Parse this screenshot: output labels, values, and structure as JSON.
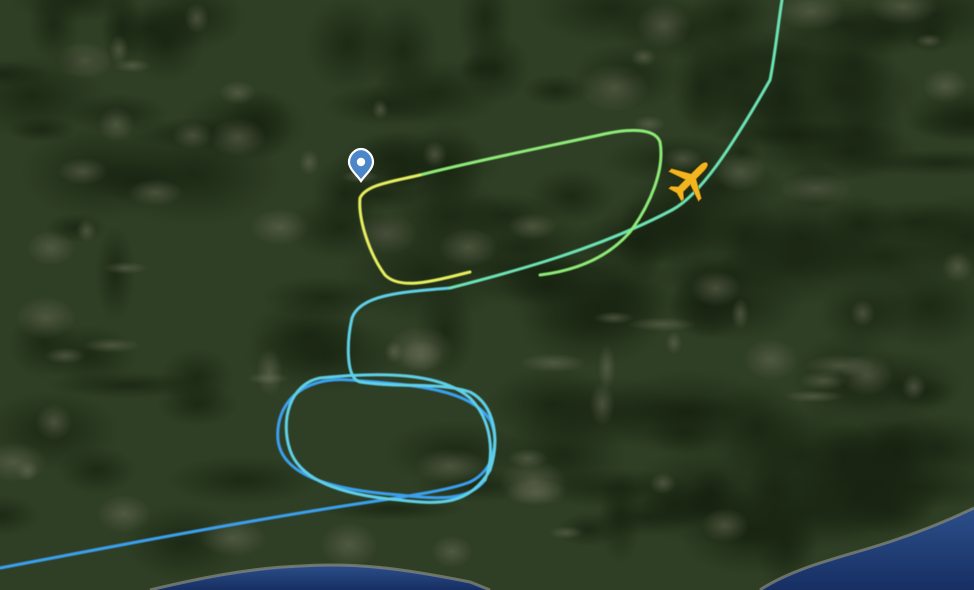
{
  "map": {
    "view": "satellite",
    "colors": {
      "land": "#2f3f25",
      "land_dark": "#1f2e1a",
      "land_light": "#4d5a3a",
      "sea": "#1d3f78",
      "sea_light": "#3b5fa0",
      "coast": "#8b8a78",
      "aircraft": "#f2b51f",
      "marker": "#4b86c8"
    },
    "flight_track": {
      "altitude_gradient": [
        "#3aa0f0",
        "#5fd0e8",
        "#6ce3b6",
        "#8eeb78",
        "#e8f060"
      ]
    },
    "aircraft": {
      "icon": "airplane-icon",
      "heading_deg": 45
    },
    "marker": {
      "icon": "location-pin-icon",
      "label": ""
    }
  }
}
